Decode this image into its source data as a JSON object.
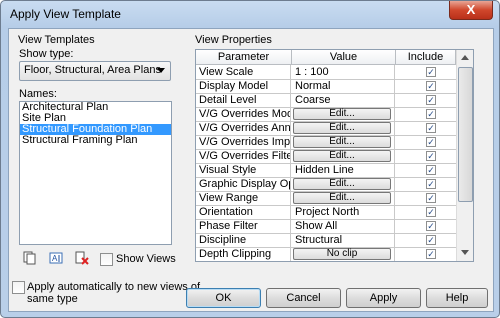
{
  "window": {
    "title": "Apply View Template",
    "close_glyph": "X"
  },
  "left": {
    "section_label": "View Templates",
    "show_type_label": "Show type:",
    "show_type_value": "Floor, Structural, Area Plans",
    "names_label": "Names:",
    "names": [
      "Architectural Plan",
      "Site Plan",
      "Structural Foundation Plan",
      "Structural Framing Plan"
    ],
    "selected_index": 2,
    "toolbar_icons": [
      "duplicate-icon",
      "rename-icon",
      "delete-icon"
    ],
    "show_views_label": "Show Views",
    "apply_auto_label_line1": "Apply automatically to new views of",
    "apply_auto_label_line2": "same type"
  },
  "right": {
    "section_label": "View Properties",
    "columns": [
      "Parameter",
      "Value",
      "Include"
    ],
    "rows": [
      {
        "param": "View Scale",
        "value": "1 : 100",
        "button": false,
        "include": true
      },
      {
        "param": "Display Model",
        "value": "Normal",
        "button": false,
        "include": true
      },
      {
        "param": "Detail Level",
        "value": "Coarse",
        "button": false,
        "include": true
      },
      {
        "param": "V/G Overrides Model",
        "value": "Edit...",
        "button": true,
        "include": true
      },
      {
        "param": "V/G Overrides Annotati",
        "value": "Edit...",
        "button": true,
        "include": true
      },
      {
        "param": "V/G Overrides Import",
        "value": "Edit...",
        "button": true,
        "include": true
      },
      {
        "param": "V/G Overrides Filters",
        "value": "Edit...",
        "button": true,
        "include": true
      },
      {
        "param": "Visual Style",
        "value": "Hidden Line",
        "button": false,
        "include": true
      },
      {
        "param": "Graphic Display Option",
        "value": "Edit...",
        "button": true,
        "include": true
      },
      {
        "param": "View Range",
        "value": "Edit...",
        "button": true,
        "include": true
      },
      {
        "param": "Orientation",
        "value": "Project North",
        "button": false,
        "include": true
      },
      {
        "param": "Phase Filter",
        "value": "Show All",
        "button": false,
        "include": true
      },
      {
        "param": "Discipline",
        "value": "Structural",
        "button": false,
        "include": true
      },
      {
        "param": "Depth Clipping",
        "value": "No clip",
        "button": true,
        "include": true
      }
    ]
  },
  "buttons": {
    "ok": "OK",
    "cancel": "Cancel",
    "apply": "Apply",
    "help": "Help"
  }
}
